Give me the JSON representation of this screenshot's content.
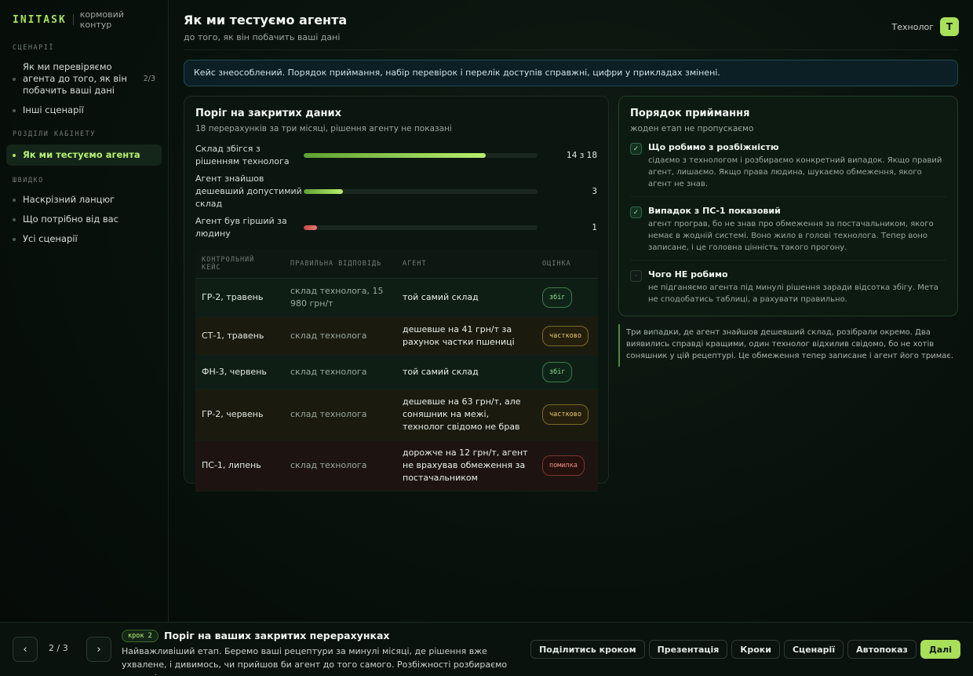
{
  "brand": {
    "logo": "INITASK",
    "subtitle": "кормовий контур"
  },
  "sidebar": {
    "sections": [
      {
        "label": "СЦЕНАРІЇ"
      },
      {
        "label": "РОЗДІЛИ КАБІНЕТУ"
      },
      {
        "label": "ШВИДКО"
      }
    ],
    "scenario_items": [
      {
        "label": "Як ми перевіряємо агента до того, як він побачить ваші дані",
        "count": "2/3"
      },
      {
        "label": "Інші сценарії"
      }
    ],
    "cabinet_items": [
      {
        "label": "Як ми тестуємо агента",
        "active": true
      }
    ],
    "quick_items": [
      {
        "label": "Наскрізний ланцюг"
      },
      {
        "label": "Що потрібно від вас"
      },
      {
        "label": "Усі сценарії"
      }
    ]
  },
  "header": {
    "title": "Як ми тестуємо агента",
    "subtitle": "до того, як він побачить ваші дані",
    "user_role": "Технолог",
    "avatar_letter": "Т"
  },
  "notice": "Кейс знеособлений. Порядок приймання, набір перевірок і перелік доступів справжні, цифри у прикладах змінені.",
  "threshold_card": {
    "title": "Поріг на закритих даних",
    "subtitle": "18 перерахунків за три місяці, рішення агенту не показані",
    "metrics": [
      {
        "label": "Склад збігся з рішенням технолога",
        "value_text": "14 з 18",
        "fraction": 0.7778,
        "tone": "green"
      },
      {
        "label": "Агент знайшов дешевший допустимий склад",
        "value_text": "3",
        "fraction": 0.1667,
        "tone": "green"
      },
      {
        "label": "Агент був гірший за людину",
        "value_text": "1",
        "fraction": 0.0556,
        "tone": "red"
      }
    ],
    "table": {
      "headers": [
        "КОНТРОЛЬНИЙ КЕЙС",
        "ПРАВИЛЬНА ВІДПОВІДЬ",
        "АГЕНТ",
        "ОЦІНКА"
      ],
      "rows": [
        {
          "case": "ГР-2, травень",
          "correct": "склад технолога, 15 980 грн/т",
          "agent": "той самий склад",
          "grade": "збіг",
          "tone": "ok"
        },
        {
          "case": "СТ-1, травень",
          "correct": "склад технолога",
          "agent": "дешевше на 41 грн/т за рахунок частки пшениці",
          "grade": "частково",
          "tone": "part"
        },
        {
          "case": "ФН-3, червень",
          "correct": "склад технолога",
          "agent": "той самий склад",
          "grade": "збіг",
          "tone": "ok"
        },
        {
          "case": "ГР-2, червень",
          "correct": "склад технолога",
          "agent": "дешевше на 63 грн/т, але соняшник на межі, технолог свідомо не брав",
          "grade": "частково",
          "tone": "part"
        },
        {
          "case": "ПС-1, липень",
          "correct": "склад технолога",
          "agent": "дорожче на 12 грн/т, агент не врахував обмеження за постачальником",
          "grade": "помилка",
          "tone": "err"
        }
      ]
    }
  },
  "acceptance_card": {
    "title": "Порядок приймання",
    "subtitle": "жоден етап не пропускаємо",
    "steps": [
      {
        "title": "Що робимо з розбіжністю",
        "body": "сідаємо з технологом і розбираємо конкретний випадок. Якщо правий агент, лишаємо. Якщо права людина, шукаємо обмеження, якого агент не знав.",
        "checked": true,
        "mark": "✓"
      },
      {
        "title": "Випадок з ПС-1 показовий",
        "body": "агент програв, бо не знав про обмеження за постачальником, якого немає в жодній системі. Воно жило в голові технолога. Тепер воно записане, і це головна цінність такого прогону.",
        "checked": true,
        "mark": "✓"
      },
      {
        "title": "Чого НЕ робимо",
        "body": "не підганяємо агента під минулі рішення заради відсотка збігу. Мета не сподобатись таблиці, а рахувати правильно.",
        "checked": false,
        "mark": "·"
      }
    ]
  },
  "quote": "Три випадки, де агент знайшов дешевший склад, розібрали окремо. Два виявились справді кращими, один технолог відхилив свідомо, бо не хотів соняшник у цій рецептурі. Це обмеження тепер записане і агент його тримає.",
  "footer": {
    "prev_icon": "‹",
    "next_icon": "›",
    "page": "2 / 3",
    "step_tag": "крок 2",
    "title": "Поріг на ваших закритих перерахунках",
    "description": "Найважливіший етап. Беремо ваші рецептури за минулі місяці, де рішення вже ухвалене, і дивимось, чи прийшов би агент до того самого. Розбіжності розбираємо разом, і не...",
    "actions": [
      "Поділитись кроком",
      "Презентація",
      "Кроки",
      "Сценарії",
      "Автопоказ",
      "Далі"
    ]
  }
}
